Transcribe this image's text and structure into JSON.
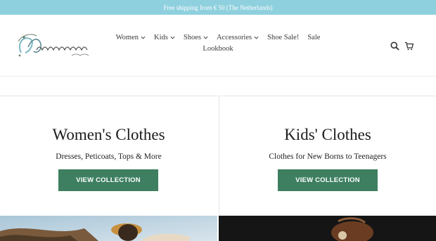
{
  "announcement": {
    "text": "Free shipping from € 50 (The Netherlands)"
  },
  "header": {
    "nav_row1": [
      {
        "label": "Women",
        "has_dropdown": true
      },
      {
        "label": "Kids",
        "has_dropdown": true
      },
      {
        "label": "Shoes",
        "has_dropdown": true
      },
      {
        "label": "Accessories",
        "has_dropdown": true
      },
      {
        "label": "Shoe Sale!",
        "has_dropdown": false
      },
      {
        "label": "Sale",
        "has_dropdown": false
      }
    ],
    "nav_row2": [
      {
        "label": "Lookbook",
        "has_dropdown": false
      }
    ],
    "icons": [
      "search-icon",
      "cart-icon"
    ]
  },
  "collections": [
    {
      "title": "Women's Clothes",
      "subtitle": "Dresses, Peticoats, Tops & More",
      "button": "VIEW COLLECTION"
    },
    {
      "title": "Kids' Clothes",
      "subtitle": "Clothes for New Borns to Teenagers",
      "button": "VIEW COLLECTION"
    }
  ],
  "colors": {
    "announcement_bg": "#8fd0de",
    "button_bg": "#3d7f60",
    "text": "#1d1d1d"
  }
}
